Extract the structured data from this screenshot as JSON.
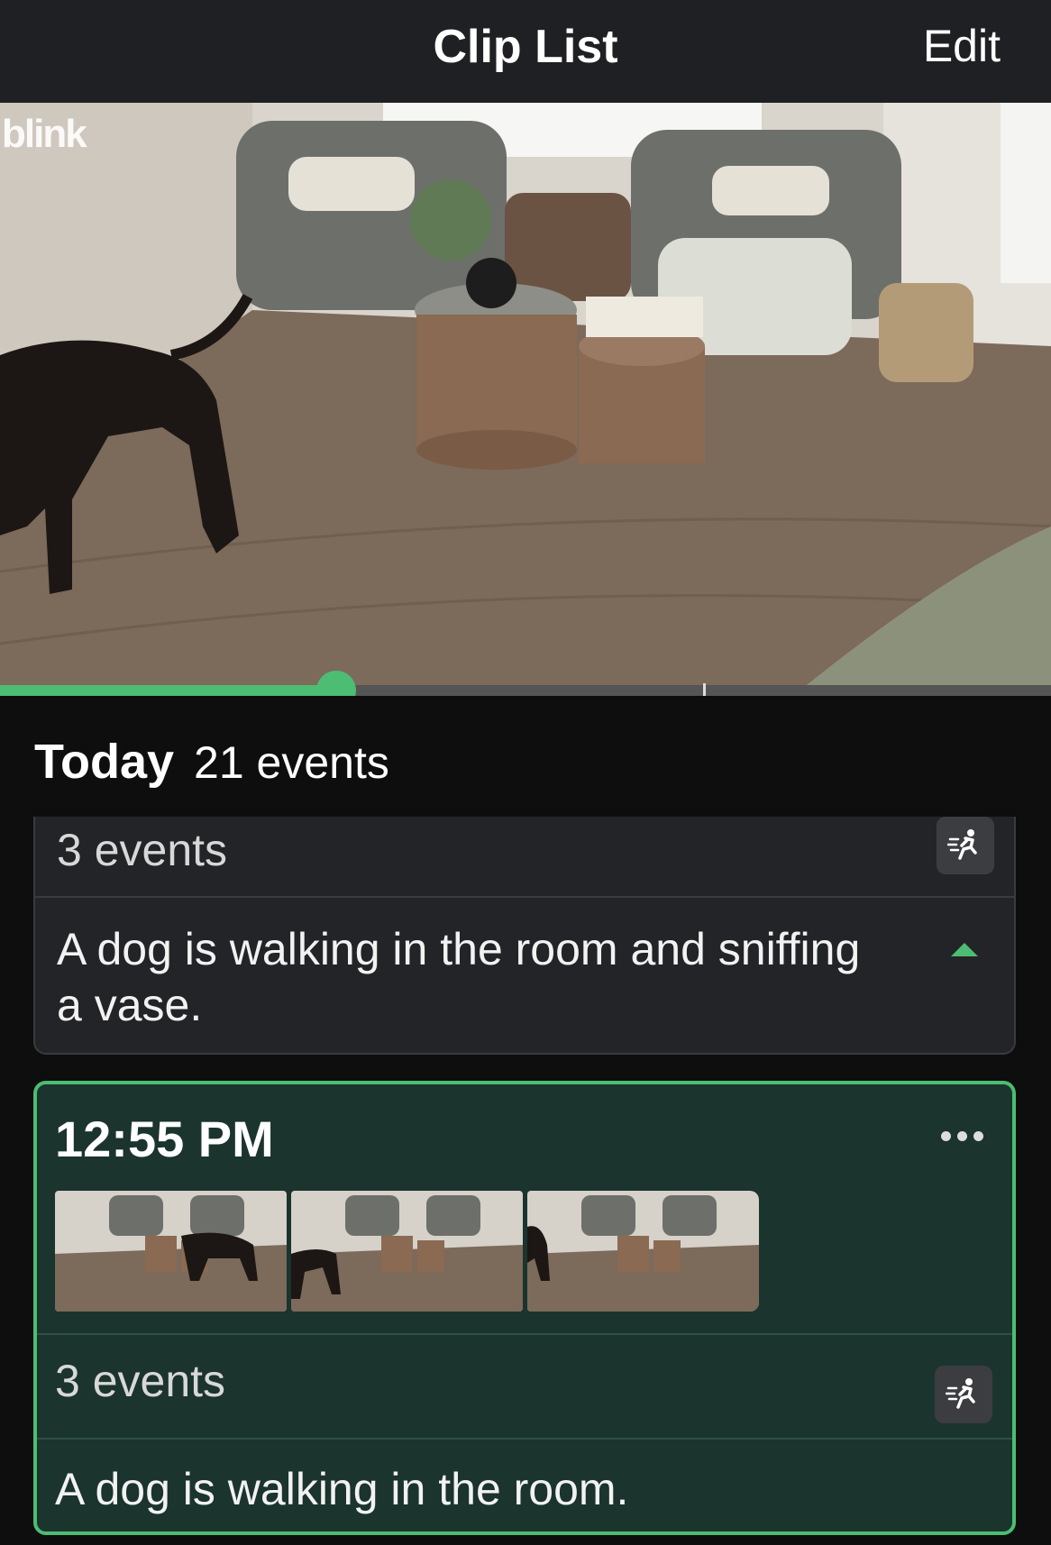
{
  "header": {
    "title": "Clip List",
    "edit_label": "Edit"
  },
  "video": {
    "watermark": "blink",
    "playback_progress": 0.32
  },
  "day_group": {
    "day_label": "Today",
    "count_label": "21 events"
  },
  "clips": [
    {
      "events_label": "3 events",
      "description": "A dog is walking in the room and sniffing a vase.",
      "motion_icon": "motion-runner-icon",
      "expanded": true
    },
    {
      "time": "12:55 PM",
      "events_label": "3 events",
      "description": "A dog is walking in the room.",
      "motion_icon": "motion-runner-icon",
      "more_icon": "more-dots-icon",
      "thumbnails": 3,
      "selected": true
    }
  ],
  "colors": {
    "accent": "#4cbd72",
    "header_bg": "#1f2023",
    "card_bg": "#232427",
    "selected_card_bg": "#1b342d"
  }
}
